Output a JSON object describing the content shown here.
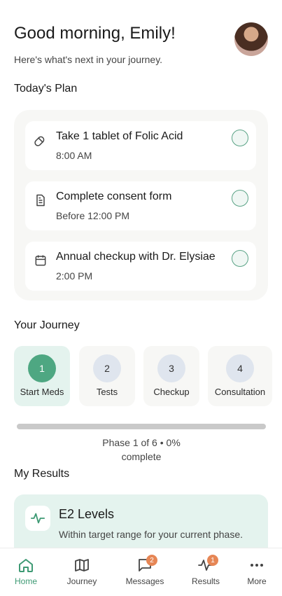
{
  "header": {
    "greeting": "Good morning, Emily!",
    "subtitle": "Here's what's next in your journey."
  },
  "plan": {
    "title": "Today's Plan",
    "tasks": [
      {
        "title": "Take 1 tablet of Folic Acid",
        "time": "8:00 AM",
        "icon": "pill-icon"
      },
      {
        "title": "Complete consent form",
        "time": "Before 12:00 PM",
        "icon": "document-icon"
      },
      {
        "title": "Annual checkup with Dr. Elysiae",
        "time": "2:00 PM",
        "icon": "calendar-icon"
      }
    ]
  },
  "journey": {
    "title": "Your Journey",
    "steps": [
      {
        "num": "1",
        "label": "Start Meds",
        "active": true
      },
      {
        "num": "2",
        "label": "Tests",
        "active": false
      },
      {
        "num": "3",
        "label": "Checkup",
        "active": false
      },
      {
        "num": "4",
        "label": "Consultation",
        "active": false
      }
    ],
    "progress_line1": "Phase 1 of 6 • 0%",
    "progress_line2": "complete",
    "progress_fraction": 0
  },
  "results": {
    "title": "My Results",
    "card_title": "E2 Levels",
    "card_desc": "Within target range for your current phase.",
    "icon": "activity-icon"
  },
  "nav": {
    "items": [
      {
        "label": "Home",
        "icon": "home-icon",
        "active": true,
        "badge": ""
      },
      {
        "label": "Journey",
        "icon": "map-icon",
        "active": false,
        "badge": ""
      },
      {
        "label": "Messages",
        "icon": "message-icon",
        "active": false,
        "badge": "2"
      },
      {
        "label": "Results",
        "icon": "activity-icon",
        "active": false,
        "badge": "1"
      },
      {
        "label": "More",
        "icon": "more-icon",
        "active": false,
        "badge": ""
      }
    ]
  },
  "colors": {
    "accent": "#4ea782",
    "accent_light": "#e4f3ee",
    "badge": "#e68655"
  }
}
